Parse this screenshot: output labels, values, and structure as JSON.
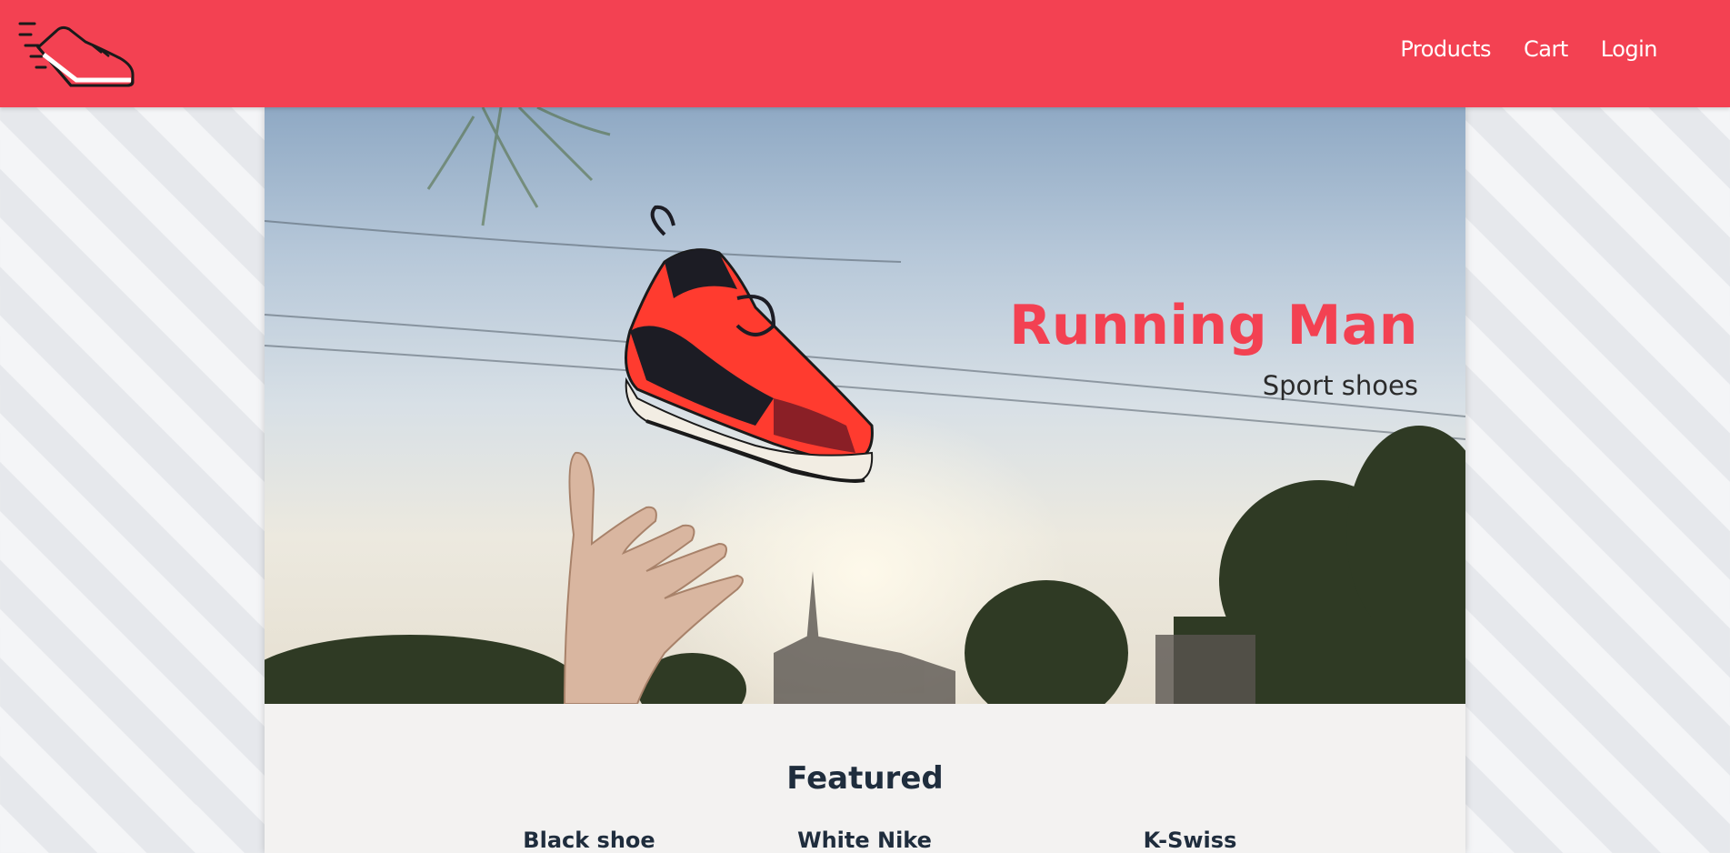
{
  "navbar": {
    "logo_icon": "running-shoe-icon",
    "links": [
      "Products",
      "Cart",
      "Login"
    ]
  },
  "hero": {
    "title": "Running Man",
    "subtitle": "Sport shoes"
  },
  "featured": {
    "title": "Featured",
    "products": [
      "Black shoe",
      "White Nike",
      "K-Swiss"
    ]
  },
  "colors": {
    "brand": "#f34152",
    "text_dark": "#1f2d3d"
  }
}
